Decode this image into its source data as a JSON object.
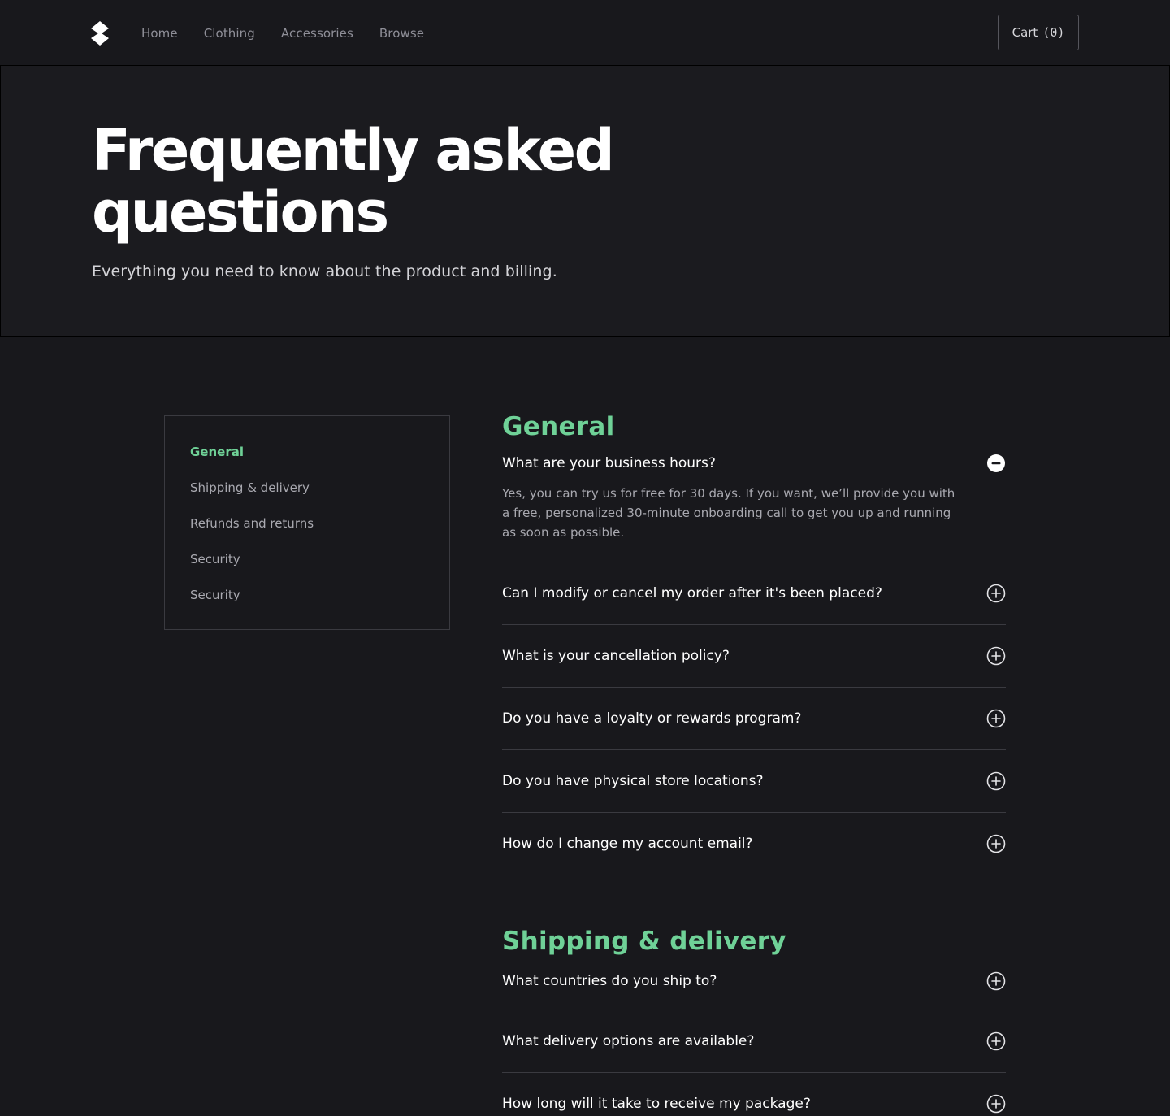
{
  "nav": {
    "links": [
      "Home",
      "Clothing",
      "Accessories",
      "Browse"
    ],
    "cart_label": "Cart",
    "cart_count": "(0)"
  },
  "hero": {
    "title": "Frequently asked questions",
    "subtitle": "Everything you need to know about the product and billing."
  },
  "sidebar": {
    "items": [
      "General",
      "Shipping & delivery",
      "Refunds and returns",
      "Security",
      "Security"
    ],
    "active_index": 0
  },
  "faq": {
    "general": {
      "heading": "General",
      "items": [
        {
          "question": "What are your business hours?",
          "answer": "Yes, you can try us for free for 30 days. If you want, we’ll provide you with a free, personalized 30-minute onboarding call to get you up and running as soon as possible.",
          "expanded": true
        },
        {
          "question": "Can I modify or cancel my order after it's been placed?",
          "expanded": false
        },
        {
          "question": "What is your cancellation policy?",
          "expanded": false
        },
        {
          "question": "Do you have a loyalty or rewards program?",
          "expanded": false
        },
        {
          "question": "Do you have physical store locations?",
          "expanded": false
        },
        {
          "question": "How do I change my account email?",
          "expanded": false
        }
      ]
    },
    "shipping": {
      "heading": "Shipping & delivery",
      "items": [
        {
          "question": "What countries do you ship to?",
          "expanded": false
        },
        {
          "question": "What delivery options are available?",
          "expanded": false
        },
        {
          "question": "How long will it take to receive my package?",
          "expanded": false
        }
      ]
    }
  },
  "colors": {
    "background": "#18181c",
    "accent": "#6fd197",
    "muted_text": "#a9a9b0",
    "border": "#3a3a40"
  },
  "icons": {
    "logo": "brand-logo-icon",
    "expand": "plus-circle-icon",
    "collapse": "minus-circle-icon"
  }
}
